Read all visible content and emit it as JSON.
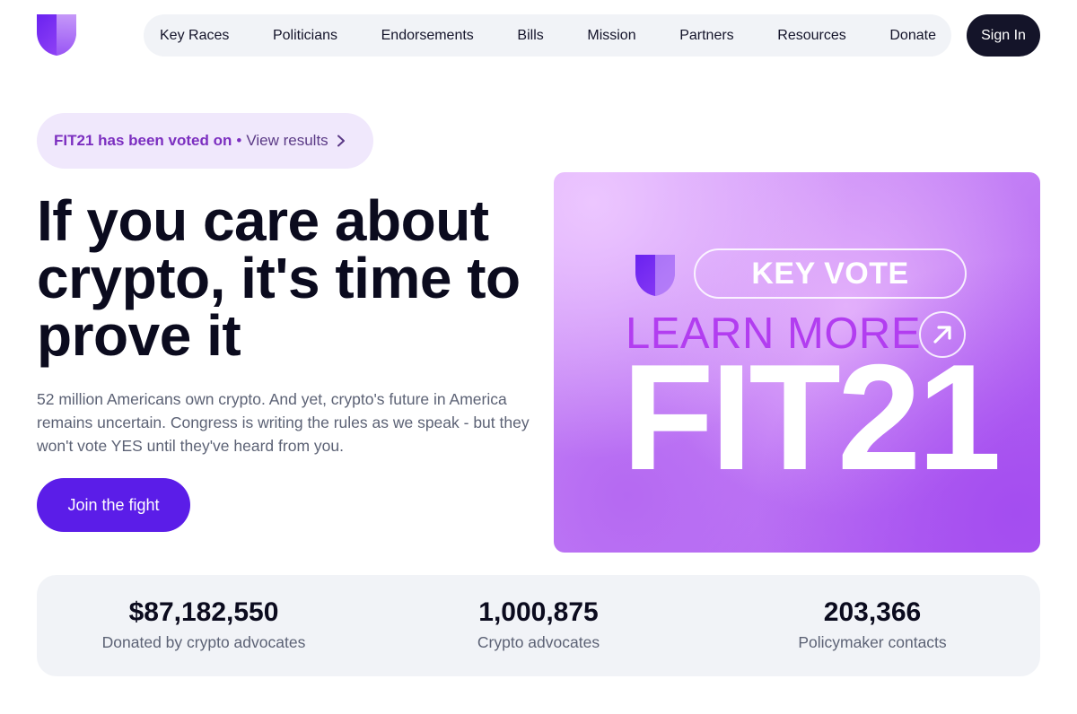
{
  "colors": {
    "brand_purple": "#5b1de8",
    "dark": "#141429",
    "pill_bg": "#f0e8fc",
    "stats_bg": "#f1f3f7"
  },
  "header": {
    "logo_icon": "shield-logo-icon",
    "nav": [
      {
        "label": "Key Races"
      },
      {
        "label": "Politicians"
      },
      {
        "label": "Endorsements"
      },
      {
        "label": "Bills"
      },
      {
        "label": "Mission"
      },
      {
        "label": "Partners"
      },
      {
        "label": "Resources"
      },
      {
        "label": "Donate"
      }
    ],
    "sign_in_label": "Sign In"
  },
  "announcement": {
    "strong": "FIT21 has been voted on",
    "separator": "•",
    "link": "View results",
    "chevron_icon": "chevron-right-icon"
  },
  "hero": {
    "headline": "If you care about crypto, it's time to prove it",
    "subtext": "52 million Americans own crypto. And yet, crypto's future in America remains uncertain. Congress is writing the rules as we speak - but they won't vote YES until they've heard from you.",
    "cta_label": "Join the fight"
  },
  "promo": {
    "badge": "KEY VOTE",
    "learn_more": "LEARN MORE",
    "arrow_icon": "arrow-up-right-icon",
    "big_text": "FIT21"
  },
  "stats": [
    {
      "value": "$87,182,550",
      "label": "Donated by crypto advocates"
    },
    {
      "value": "1,000,875",
      "label": "Crypto advocates"
    },
    {
      "value": "203,366",
      "label": "Policymaker contacts"
    }
  ]
}
